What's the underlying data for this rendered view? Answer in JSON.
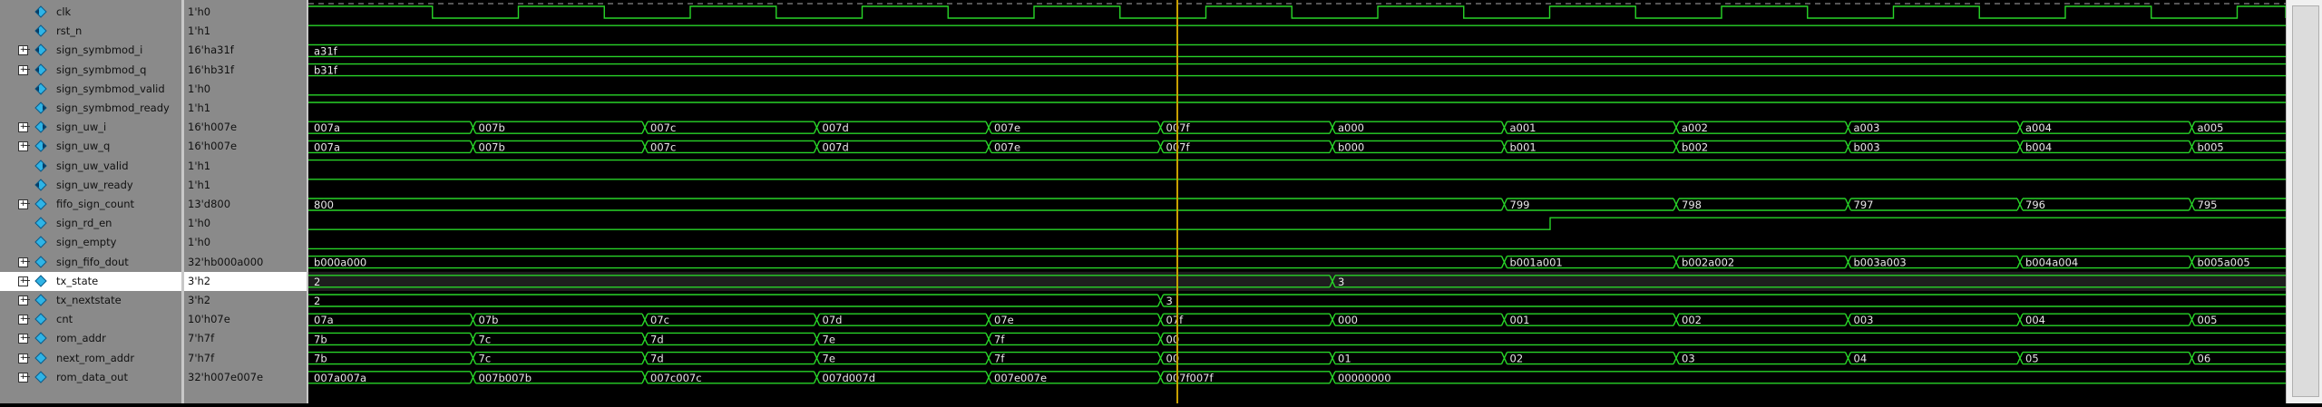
{
  "signals": [
    {
      "name": "clk",
      "value": "1'h0",
      "expand": false,
      "icon": "signal-in-icon",
      "kind": "clock"
    },
    {
      "name": "rst_n",
      "value": "1'h1",
      "expand": false,
      "icon": "signal-in-icon",
      "kind": "high"
    },
    {
      "name": "sign_symbmod_i",
      "value": "16'ha31f",
      "expand": true,
      "icon": "signal-in-icon",
      "kind": "bus",
      "segs": [
        {
          "at": 0,
          "label": "a31f"
        }
      ]
    },
    {
      "name": "sign_symbmod_q",
      "value": "16'hb31f",
      "expand": true,
      "icon": "signal-in-icon",
      "kind": "bus",
      "segs": [
        {
          "at": 0,
          "label": "b31f"
        }
      ]
    },
    {
      "name": "sign_symbmod_valid",
      "value": "1'h0",
      "expand": false,
      "icon": "signal-in-icon",
      "kind": "low"
    },
    {
      "name": "sign_symbmod_ready",
      "value": "1'h1",
      "expand": false,
      "icon": "signal-out-icon",
      "kind": "high"
    },
    {
      "name": "sign_uw_i",
      "value": "16'h007e",
      "expand": true,
      "icon": "signal-out-icon",
      "kind": "bus",
      "segs": [
        {
          "at": 0,
          "label": "007a"
        },
        {
          "at": 1,
          "label": "007b"
        },
        {
          "at": 2,
          "label": "007c"
        },
        {
          "at": 3,
          "label": "007d"
        },
        {
          "at": 4,
          "label": "007e"
        },
        {
          "at": 5,
          "label": "007f"
        },
        {
          "at": 6,
          "label": "a000"
        },
        {
          "at": 7,
          "label": "a001"
        },
        {
          "at": 8,
          "label": "a002"
        },
        {
          "at": 9,
          "label": "a003"
        },
        {
          "at": 10,
          "label": "a004"
        },
        {
          "at": 11,
          "label": "a005"
        }
      ]
    },
    {
      "name": "sign_uw_q",
      "value": "16'h007e",
      "expand": true,
      "icon": "signal-out-icon",
      "kind": "bus",
      "segs": [
        {
          "at": 0,
          "label": "007a"
        },
        {
          "at": 1,
          "label": "007b"
        },
        {
          "at": 2,
          "label": "007c"
        },
        {
          "at": 3,
          "label": "007d"
        },
        {
          "at": 4,
          "label": "007e"
        },
        {
          "at": 5,
          "label": "007f"
        },
        {
          "at": 6,
          "label": "b000"
        },
        {
          "at": 7,
          "label": "b001"
        },
        {
          "at": 8,
          "label": "b002"
        },
        {
          "at": 9,
          "label": "b003"
        },
        {
          "at": 10,
          "label": "b004"
        },
        {
          "at": 11,
          "label": "b005"
        }
      ]
    },
    {
      "name": "sign_uw_valid",
      "value": "1'h1",
      "expand": false,
      "icon": "signal-out-icon",
      "kind": "high"
    },
    {
      "name": "sign_uw_ready",
      "value": "1'h1",
      "expand": false,
      "icon": "signal-in-icon",
      "kind": "high"
    },
    {
      "name": "fifo_sign_count",
      "value": "13'd800",
      "expand": true,
      "icon": "signal-internal-icon",
      "kind": "bus",
      "segs": [
        {
          "at": 0,
          "label": "800"
        },
        {
          "at": 7,
          "label": "799"
        },
        {
          "at": 8,
          "label": "798"
        },
        {
          "at": 9,
          "label": "797"
        },
        {
          "at": 10,
          "label": "796"
        },
        {
          "at": 11,
          "label": "795"
        }
      ]
    },
    {
      "name": "sign_rd_en",
      "value": "1'h0",
      "expand": false,
      "icon": "signal-internal-icon",
      "kind": "rden"
    },
    {
      "name": "sign_empty",
      "value": "1'h0",
      "expand": false,
      "icon": "signal-internal-icon",
      "kind": "low"
    },
    {
      "name": "sign_fifo_dout",
      "value": "32'hb000a000",
      "expand": true,
      "icon": "signal-internal-icon",
      "kind": "bus",
      "segs": [
        {
          "at": 0,
          "label": "b000a000"
        },
        {
          "at": 7,
          "label": "b001a001"
        },
        {
          "at": 8,
          "label": "b002a002"
        },
        {
          "at": 9,
          "label": "b003a003"
        },
        {
          "at": 10,
          "label": "b004a004"
        },
        {
          "at": 11,
          "label": "b005a005"
        }
      ]
    },
    {
      "name": "tx_state",
      "value": "3'h2",
      "expand": true,
      "icon": "signal-internal-icon",
      "kind": "bus",
      "selected": true,
      "segs": [
        {
          "at": 0,
          "label": "2"
        },
        {
          "at": 6,
          "label": "3"
        }
      ]
    },
    {
      "name": "tx_nextstate",
      "value": "3'h2",
      "expand": true,
      "icon": "signal-internal-icon",
      "kind": "bus",
      "segs": [
        {
          "at": 0,
          "label": "2"
        },
        {
          "at": 5,
          "label": "3"
        }
      ]
    },
    {
      "name": "cnt",
      "value": "10'h07e",
      "expand": true,
      "icon": "signal-internal-icon",
      "kind": "bus",
      "segs": [
        {
          "at": 0,
          "label": "07a"
        },
        {
          "at": 1,
          "label": "07b"
        },
        {
          "at": 2,
          "label": "07c"
        },
        {
          "at": 3,
          "label": "07d"
        },
        {
          "at": 4,
          "label": "07e"
        },
        {
          "at": 5,
          "label": "07f"
        },
        {
          "at": 6,
          "label": "000"
        },
        {
          "at": 7,
          "label": "001"
        },
        {
          "at": 8,
          "label": "002"
        },
        {
          "at": 9,
          "label": "003"
        },
        {
          "at": 10,
          "label": "004"
        },
        {
          "at": 11,
          "label": "005"
        }
      ]
    },
    {
      "name": "rom_addr",
      "value": "7'h7f",
      "expand": true,
      "icon": "signal-internal-icon",
      "kind": "bus",
      "segs": [
        {
          "at": 0,
          "label": "7b"
        },
        {
          "at": 1,
          "label": "7c"
        },
        {
          "at": 2,
          "label": "7d"
        },
        {
          "at": 3,
          "label": "7e"
        },
        {
          "at": 4,
          "label": "7f"
        },
        {
          "at": 5,
          "label": "00"
        }
      ]
    },
    {
      "name": "next_rom_addr",
      "value": "7'h7f",
      "expand": true,
      "icon": "signal-internal-icon",
      "kind": "bus",
      "segs": [
        {
          "at": 0,
          "label": "7b"
        },
        {
          "at": 1,
          "label": "7c"
        },
        {
          "at": 2,
          "label": "7d"
        },
        {
          "at": 3,
          "label": "7e"
        },
        {
          "at": 4,
          "label": "7f"
        },
        {
          "at": 5,
          "label": "00"
        },
        {
          "at": 6,
          "label": "01"
        },
        {
          "at": 7,
          "label": "02"
        },
        {
          "at": 8,
          "label": "03"
        },
        {
          "at": 9,
          "label": "04"
        },
        {
          "at": 10,
          "label": "05"
        },
        {
          "at": 11,
          "label": "06"
        }
      ]
    },
    {
      "name": "rom_data_out",
      "value": "32'h007e007e",
      "expand": true,
      "icon": "signal-internal-icon",
      "kind": "bus",
      "segs": [
        {
          "at": 0,
          "label": "007a007a"
        },
        {
          "at": 1,
          "label": "007b007b"
        },
        {
          "at": 2,
          "label": "007c007c"
        },
        {
          "at": 3,
          "label": "007d007d"
        },
        {
          "at": 4,
          "label": "007e007e"
        },
        {
          "at": 5,
          "label": "007f007f"
        },
        {
          "at": 6,
          "label": "00000000"
        }
      ]
    }
  ],
  "colors": {
    "wave": "#28d428",
    "name_panel": "#8a8a8a",
    "cursor": "#c8a000",
    "selected_row": "#ffffff"
  }
}
